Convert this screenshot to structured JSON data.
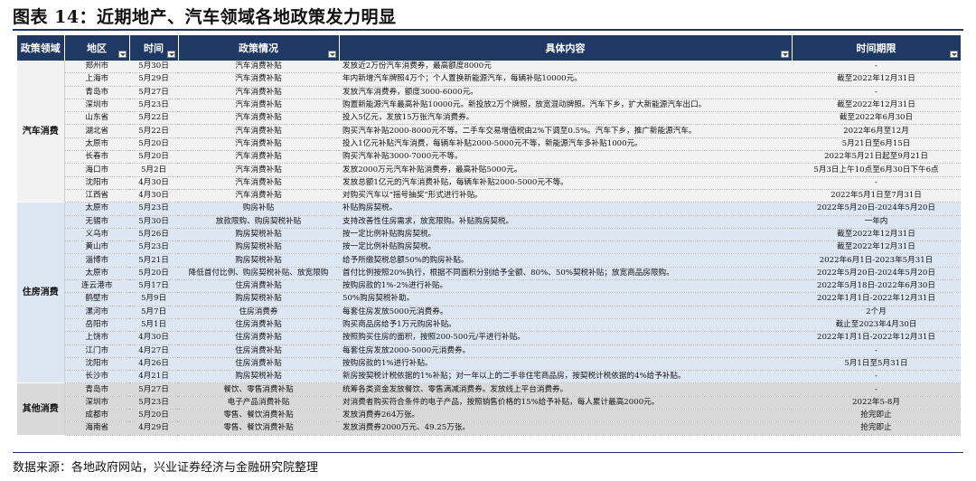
{
  "title": "图表 14：近期地产、汽车领域各地政策发力明显",
  "columns": [
    "政策领域",
    "地区",
    "时间",
    "政策情况",
    "具体内容",
    "时间期限"
  ],
  "groups": [
    {
      "name": "汽车消费",
      "rows": [
        [
          "郑州市",
          "5月30日",
          "汽车消费补贴",
          "发放近2万份汽车消费券，最高额度8000元",
          "-"
        ],
        [
          "上海市",
          "5月29日",
          "汽车消费补贴",
          "年内新增汽车牌照4万个；个人置换新能源汽车，每辆补贴10000元。",
          "截至2022年12月31日"
        ],
        [
          "青岛市",
          "5月27日",
          "汽车消费补贴",
          "发放汽车消费券，额度3000-6000元。",
          "-"
        ],
        [
          "深圳市",
          "5月23日",
          "汽车消费补贴",
          "购置新能源汽车最高补贴10000元。新投放2万个牌照，放宽混动牌照。汽车下乡，扩大新能源汽车出口。",
          "截至2022年12月31日"
        ],
        [
          "山东省",
          "5月22日",
          "汽车消费补贴",
          "投入5亿元，发放15万张汽车消费券。",
          "截至2022年6月30日"
        ],
        [
          "湖北省",
          "5月22日",
          "汽车消费补贴",
          "购买汽车补贴2000-8000元不等。二手车交易增值税由2%下调至0.5%。汽车下乡，推广新能源汽车。",
          "2022年6月至12月"
        ],
        [
          "太原市",
          "5月20日",
          "汽车消费补贴",
          "投入1亿元补贴汽车消费，每辆车补贴2000-5000元不等，新能源汽车多补贴1000元。",
          "5月21日至6月15日"
        ],
        [
          "长春市",
          "5月20日",
          "汽车消费补贴",
          "购买汽车补贴3000-7000元不等。",
          "2022年5月21日起至9月21日"
        ],
        [
          "海口市",
          "5月2日",
          "汽车消费补贴",
          "发放2000万元汽车补贴消费券，最高补贴5000元。",
          "5月3日上午10点至6月30日下午6点"
        ],
        [
          "沈阳市",
          "4月30日",
          "汽车消费补贴",
          "发放总额1亿元的汽车消费补贴，每辆车补贴2000-5000元不等。",
          "-"
        ],
        [
          "江西省",
          "4月30日",
          "汽车消费补贴",
          "对购买汽车以“摇号抽奖”形式进行补贴。",
          "2022年5月1日至7月31日"
        ]
      ]
    },
    {
      "name": "住房消费",
      "rows": [
        [
          "太原市",
          "5月23日",
          "购房补贴",
          "补贴购房契税。",
          "2022年5月20日-2024年5月20日"
        ],
        [
          "无锡市",
          "5月30日",
          "放款限购、购房契税补贴",
          "支持改善性住房需求，放宽限购。补贴购房契税。",
          "一年内"
        ],
        [
          "义乌市",
          "5月26日",
          "购房契税补贴",
          "按一定比例补贴购房契税。",
          "截至2022年12月31日"
        ],
        [
          "黄山市",
          "5月23日",
          "购房契税补贴",
          "按一定比例补贴购房契税。",
          "截至2022年12月31日"
        ],
        [
          "淄博市",
          "5月21日",
          "购房契税补贴",
          "给予所缴契税总额50%的购房补贴。",
          "2022年6月1日-2023年5月31日"
        ],
        [
          "太原市",
          "5月20日",
          "降低首付比例、购房契税补贴、放宽限购",
          "首付比例按照20%执行，根据不同面积分别给予全额、80%、50%契税补贴；放宽商品房限购。",
          "2022年5月20日-2024年5月20日"
        ],
        [
          "连云港市",
          "5月17日",
          "住房消费补贴",
          "按购房款的1%-2%进行补贴。",
          "2022年5月18日-2022年6月30日"
        ],
        [
          "鹤壁市",
          "5月9日",
          "购房契税补贴",
          "50%购房契税补助。",
          "2022年1月1日-2022年12月31日"
        ],
        [
          "漯河市",
          "5月7日",
          "住房消费券",
          "每套住房发放5000元消费券。",
          "2个月"
        ],
        [
          "岳阳市",
          "5月1日",
          "住房消费补贴",
          "购买商品房给予1万元购房补贴。",
          "截止至2023年4月30日"
        ],
        [
          "上饶市",
          "4月30日",
          "住房消费补贴",
          "按照购买住房的面积，按照200-500元/平进行补贴。",
          "2022年1月1日-2022年12月31日"
        ],
        [
          "江门市",
          "4月27日",
          "住房消费补贴",
          "每套住房发放2000-5000元消费券。",
          "-"
        ],
        [
          "沈阳市",
          "4月26日",
          "住房消费补贴",
          "按购房款的1%进行补贴。",
          "5月1日至5月31日"
        ],
        [
          "长沙市",
          "4月21日",
          "购房契税补贴",
          "新房按契税计税依据的1%补贴；对一年以上的二手非住宅商品房，按契税计税依据的4%给予补贴。",
          "-"
        ]
      ]
    },
    {
      "name": "其他消费",
      "rows": [
        [
          "青岛市",
          "5月27日",
          "餐饮、零售消费补贴",
          "统筹各类资金发放餐饮、零售满减消费券。发放线上平台消费券。",
          "-"
        ],
        [
          "深圳市",
          "5月23日",
          "电子产品消费补贴",
          "对消费者购买符合条件的电子产品，按照销售价格的15%给予补贴，每人累计最高2000元。",
          "2022年5-8月"
        ],
        [
          "成都市",
          "5月20日",
          "零售、餐饮消费补贴",
          "发放消费券264万张。",
          "抢完即止"
        ],
        [
          "海南省",
          "4月29日",
          "零售、餐饮消费补贴",
          "发放消费券2000万元、49.25万张。",
          "抢完即止"
        ]
      ]
    }
  ],
  "source": "数据来源：各地政府网站，兴业证券经济与金融研究院整理",
  "colors": {
    "header_bg": "#1f3864",
    "group1_bg": "#f2f2f2",
    "group2_bg": "#dde7f3",
    "group3_bg": "#d9d9d9"
  }
}
